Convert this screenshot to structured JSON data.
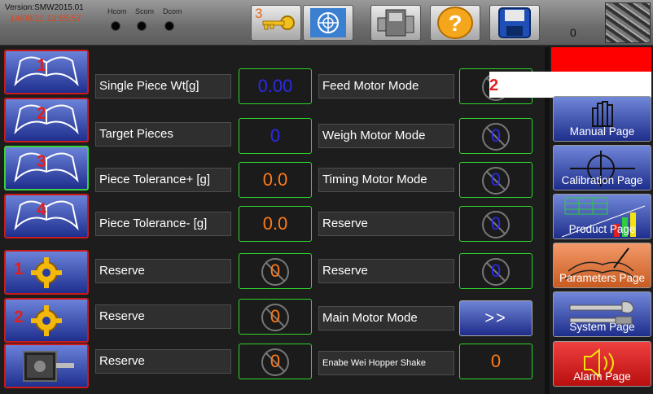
{
  "header": {
    "version": "Version:SMW2015.01",
    "datetime": "14/09/11 13:55:57",
    "com_labels": [
      "Hcom",
      "Scom",
      "Dcom"
    ],
    "key_button_number": "3",
    "counter": "0"
  },
  "left_buttons": [
    {
      "number": "1",
      "icon": "book-icon"
    },
    {
      "number": "2",
      "icon": "book-icon"
    },
    {
      "number": "3",
      "icon": "book-icon"
    },
    {
      "number": "4",
      "icon": "book-icon"
    },
    {
      "number": "1",
      "icon": "gear-icon"
    },
    {
      "number": "2",
      "icon": "gear-icon"
    },
    {
      "number": "",
      "icon": "motor-icon"
    }
  ],
  "params_left": [
    {
      "label": "Single Piece Wt[g]",
      "value": "0.00"
    },
    {
      "label": "Target Pieces",
      "value": "0"
    },
    {
      "label": "Piece Tolerance+ [g]",
      "value": "0.0"
    },
    {
      "label": "Piece Tolerance- [g]",
      "value": "0.0"
    },
    {
      "label": "Reserve",
      "value": "0"
    },
    {
      "label": "Reserve",
      "value": "0"
    },
    {
      "label": "Reserve",
      "value": "0"
    }
  ],
  "params_right": [
    {
      "label": "Feed Motor Mode",
      "value": ""
    },
    {
      "label": "Weigh Motor Mode",
      "value": "0"
    },
    {
      "label": "Timing Motor Mode",
      "value": "0"
    },
    {
      "label": "Reserve",
      "value": "0"
    },
    {
      "label": "Reserve",
      "value": "0"
    },
    {
      "label": "Main Motor Mode",
      "value": ">>"
    },
    {
      "label": "Enabe Wei Hopper Shake",
      "value": "0"
    }
  ],
  "overlay": {
    "number": "2"
  },
  "pages": [
    {
      "label": "Manual Page"
    },
    {
      "label": "Calibration Page"
    },
    {
      "label": "Product Page"
    },
    {
      "label": "Parameters Page"
    },
    {
      "label": "System Page"
    },
    {
      "label": "Alarm Page"
    }
  ],
  "colors": {
    "accent_blue": "#2a2ae8",
    "value_orange": "#ff7a18",
    "border_green": "#2fd52f",
    "alarm_red": "#ff0000"
  }
}
